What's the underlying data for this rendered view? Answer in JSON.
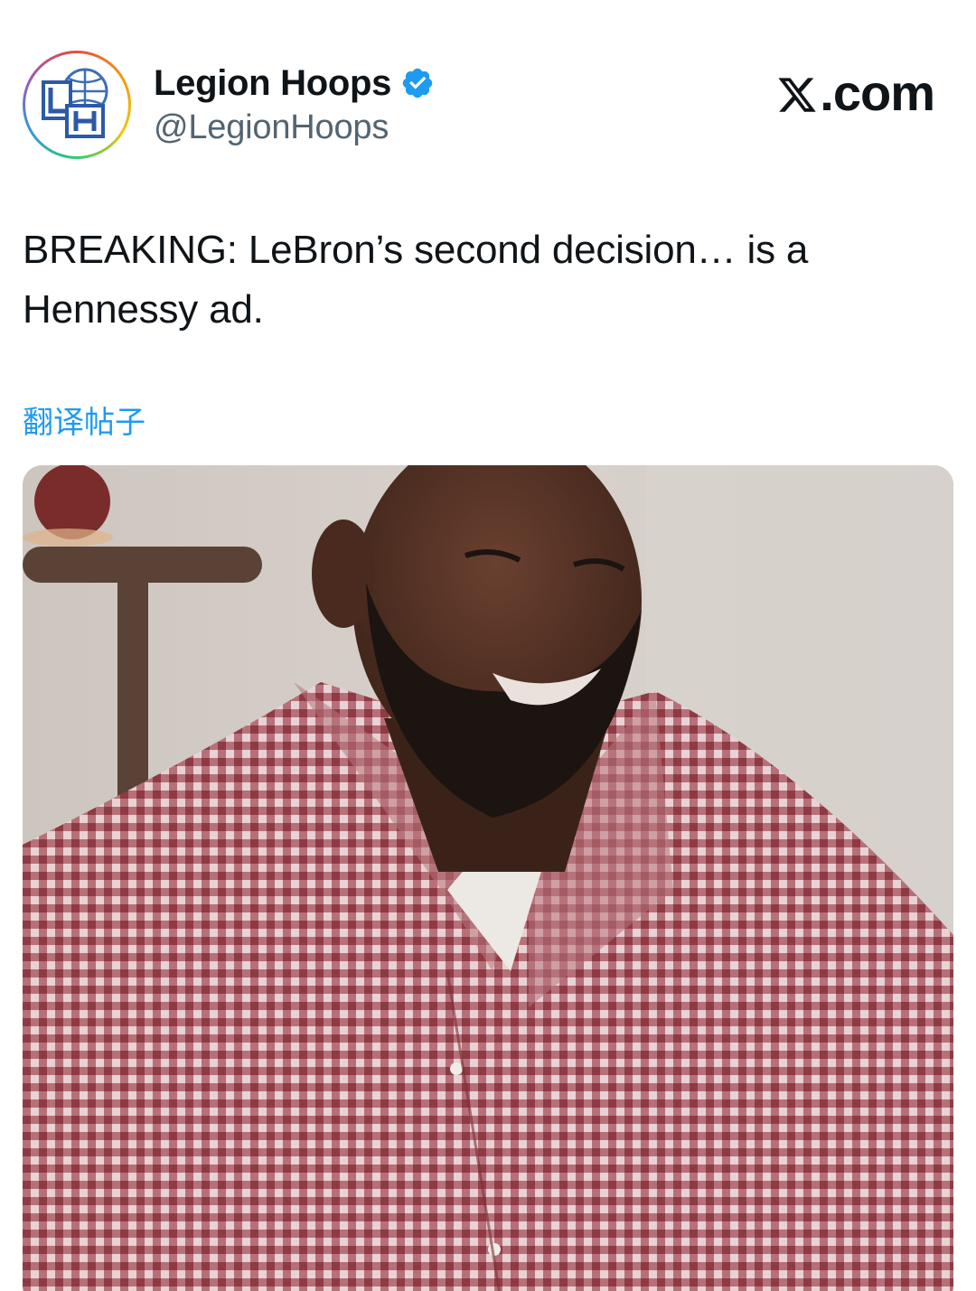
{
  "header": {
    "display_name": "Legion Hoops",
    "handle": "@LegionHoops",
    "avatar_monogram": "LH",
    "verified": true,
    "brand_label": ".com",
    "brand_icon": "x-logo-icon"
  },
  "tweet": {
    "text": "BREAKING: LeBron’s second decision… is a Hennessy ad.",
    "translate_label": "翻译帖子"
  },
  "media": {
    "type": "video-still",
    "subject": "man-in-checked-shirt"
  },
  "colors": {
    "link": "#1d9bf0",
    "verified": "#1d9bf0",
    "text_primary": "#0f1419",
    "text_secondary": "#536471"
  }
}
